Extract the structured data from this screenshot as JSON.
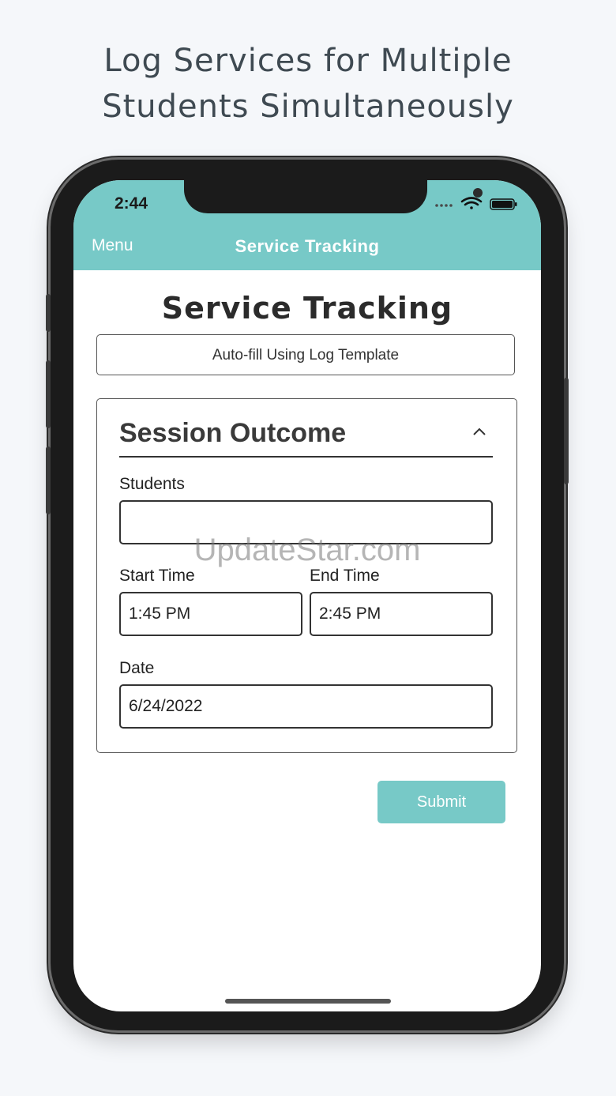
{
  "headline": {
    "line1": "Log Services for Multiple",
    "line2": "Students Simultaneously"
  },
  "status_bar": {
    "time": "2:44",
    "icons": [
      "signal-dots-icon",
      "wifi-icon",
      "battery-icon"
    ]
  },
  "nav": {
    "menu_label": "Menu",
    "title": "Service Tracking"
  },
  "page": {
    "title": "Service Tracking",
    "autofill_label": "Auto-fill Using Log Template"
  },
  "session": {
    "title": "Session Outcome",
    "students_label": "Students",
    "students_value": "",
    "start_label": "Start Time",
    "start_value": "1:45 PM",
    "end_label": "End Time",
    "end_value": "2:45 PM",
    "date_label": "Date",
    "date_value": "6/24/2022"
  },
  "watermark": "UpdateStar.com",
  "submit_label": "Submit",
  "colors": {
    "accent": "#77c9c7",
    "text": "#222222",
    "background": "#f5f7fa"
  }
}
